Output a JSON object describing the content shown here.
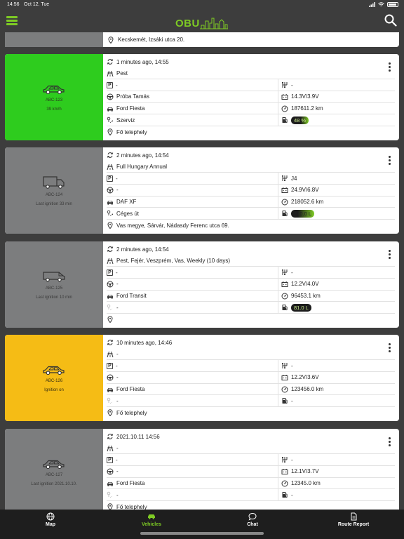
{
  "status_bar": {
    "time": "14:56",
    "date": "Oct 12. Tue",
    "battery": "100%"
  },
  "header": {
    "logo": "OBU",
    "logo_suffix": "city"
  },
  "top_strip": {
    "address": "Kecskemét, Izsáki utca 20."
  },
  "vehicles": [
    {
      "plate": "ABC-123",
      "status": "39 km/h",
      "panel_color": "green",
      "vehicle_icon": "car-icon",
      "updated": "1 minutes ago, 14:55",
      "route": "Pest",
      "parking": "-",
      "gear": "-",
      "driver": "Próba Tamás",
      "battery": "14.3V/3.9V",
      "model": "Ford Fiesta",
      "odometer": "187611.2 km",
      "trip_type": "Szerviz",
      "fuel": "48 %",
      "fuel_level": 0.48,
      "location": "Fő telephely"
    },
    {
      "plate": "ABC-124",
      "status": "Last ignition 33 min",
      "panel_color": "grey",
      "vehicle_icon": "truck-icon",
      "updated": "2 minutes ago, 14:54",
      "route": "Full Hungary Annual",
      "parking": "-",
      "gear": "J4",
      "driver": "-",
      "battery": "24.9V/6.8V",
      "model": "DAF XF",
      "odometer": "218052.6 km",
      "trip_type": "Céges út",
      "fuel": "210.0 L",
      "fuel_level": 0.7,
      "location": "Vas megye, Sárvár, Nádasdy Ferenc utca 69."
    },
    {
      "plate": "ABC-125",
      "status": "Last ignition 10 min",
      "panel_color": "grey",
      "vehicle_icon": "van-icon",
      "updated": "2 minutes ago, 14:54",
      "route": "Pest, Fejér, Veszprém, Vas, Weekly (10 days)",
      "parking": "-",
      "gear": "-",
      "driver": "-",
      "battery": "12.2V/4.0V",
      "model": "Ford Transit",
      "odometer": "96453.1 km",
      "trip_type": "-",
      "fuel": "81.0 L",
      "fuel_level": 0.0,
      "location": ""
    },
    {
      "plate": "ABC-126",
      "status": "Ignition on",
      "panel_color": "yellow",
      "vehicle_icon": "car-icon",
      "updated": "10 minutes ago, 14:46",
      "route": "-",
      "parking": "-",
      "gear": "-",
      "driver": "-",
      "battery": "12.2V/3.6V",
      "model": "Ford Fiesta",
      "odometer": "123456.0 km",
      "trip_type": "-",
      "fuel": "-",
      "location": "Fő telephely"
    },
    {
      "plate": "ABC-127",
      "status": "Last ignition 2021.10.10.",
      "panel_color": "grey",
      "vehicle_icon": "car-icon",
      "updated": "2021.10.11 14:56",
      "route": "-",
      "parking": "-",
      "gear": "-",
      "driver": "-",
      "battery": "12.1V/3.7V",
      "model": "Ford Fiesta",
      "odometer": "12345.0 km",
      "trip_type": "-",
      "fuel": "-",
      "location": "Fő telephely"
    }
  ],
  "tabbar": {
    "tabs": [
      {
        "label": "Map",
        "icon": "globe-icon"
      },
      {
        "label": "Vehicles",
        "icon": "car-icon",
        "active": true
      },
      {
        "label": "Chat",
        "icon": "chat-bubble-icon"
      },
      {
        "label": "Route Report",
        "icon": "document-icon"
      }
    ]
  },
  "colors": {
    "accent": "#7ecb24",
    "moving": "#2ecc1e",
    "idle": "#7c7d7e",
    "ignition": "#f5bc15",
    "background": "#3d3d3d"
  }
}
